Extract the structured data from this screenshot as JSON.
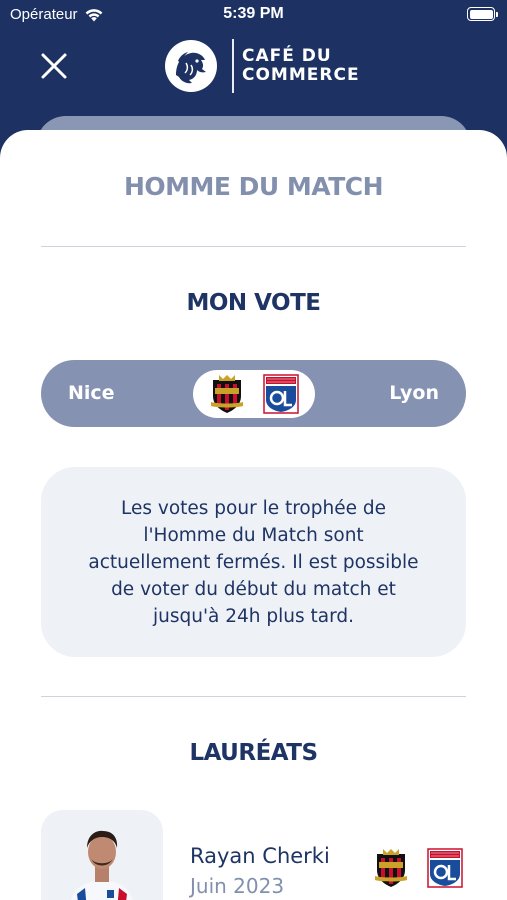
{
  "status_bar": {
    "carrier": "Opérateur",
    "time": "5:39 PM"
  },
  "header": {
    "brand_line1": "CAFÉ DU",
    "brand_line2": "COMMERCE"
  },
  "sheet": {
    "title": "HOMME DU MATCH",
    "vote_section_title": "MON VOTE",
    "match": {
      "home_team": "Nice",
      "away_team": "Lyon"
    },
    "info_message": "Les votes pour le trophée de l'Homme du Match sont actuellement fermés. Il est possible de voter du début du match et jusqu'à 24h plus tard.",
    "laureates_section_title": "LAURÉATS",
    "laureates": [
      {
        "name": "Rayan Cherki",
        "date": "Juin 2023"
      }
    ]
  },
  "colors": {
    "primary_navy": "#1d3262",
    "muted_blue": "#8592b2",
    "light_panel": "#eef1f6",
    "nice_red": "#c8102e",
    "lyon_blue": "#1a4c9c"
  },
  "icons": {
    "close": "close-icon",
    "wifi": "wifi-icon",
    "battery": "battery-icon",
    "brand": "lion-badge-icon",
    "home_crest": "ogc-nice-crest-icon",
    "away_crest": "olympique-lyonnais-crest-icon"
  }
}
